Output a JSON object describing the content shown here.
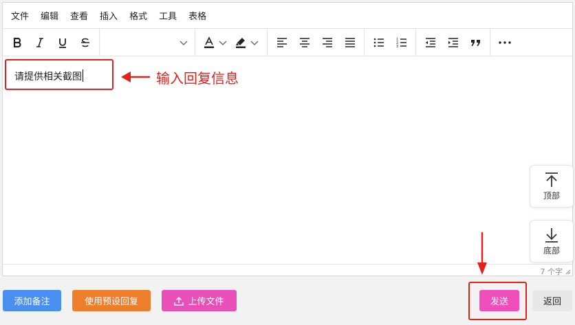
{
  "menubar": [
    "文件",
    "编辑",
    "查看",
    "插入",
    "格式",
    "工具",
    "表格"
  ],
  "editor": {
    "content": "请提供相关截图",
    "word_count": "7 个字"
  },
  "float_buttons": {
    "top_label": "顶部",
    "bottom_label": "底部"
  },
  "buttons": {
    "add_note": "添加备注",
    "use_preset": "使用预设回复",
    "upload": "上传文件",
    "send": "发送",
    "back": "返回"
  },
  "annotation": {
    "text": "输入回复信息"
  },
  "colors": {
    "add_note": "#4a8ef0",
    "use_preset": "#ec7e2c",
    "upload": "#e94fb8",
    "send": "#f04fbb",
    "back_bg": "#e8e8e8",
    "annotation": "#e4201d"
  },
  "icons": [
    "bold-icon",
    "italic-icon",
    "underline-icon",
    "strikethrough-icon",
    "chevron-down-icon",
    "font-color-icon",
    "highlight-icon",
    "align-left-icon",
    "align-center-icon",
    "align-right-icon",
    "align-justify-icon",
    "bullet-list-icon",
    "numbered-list-icon",
    "outdent-icon",
    "indent-icon",
    "blockquote-icon",
    "more-icon",
    "arrow-up-icon",
    "arrow-down-icon",
    "upload-icon"
  ]
}
